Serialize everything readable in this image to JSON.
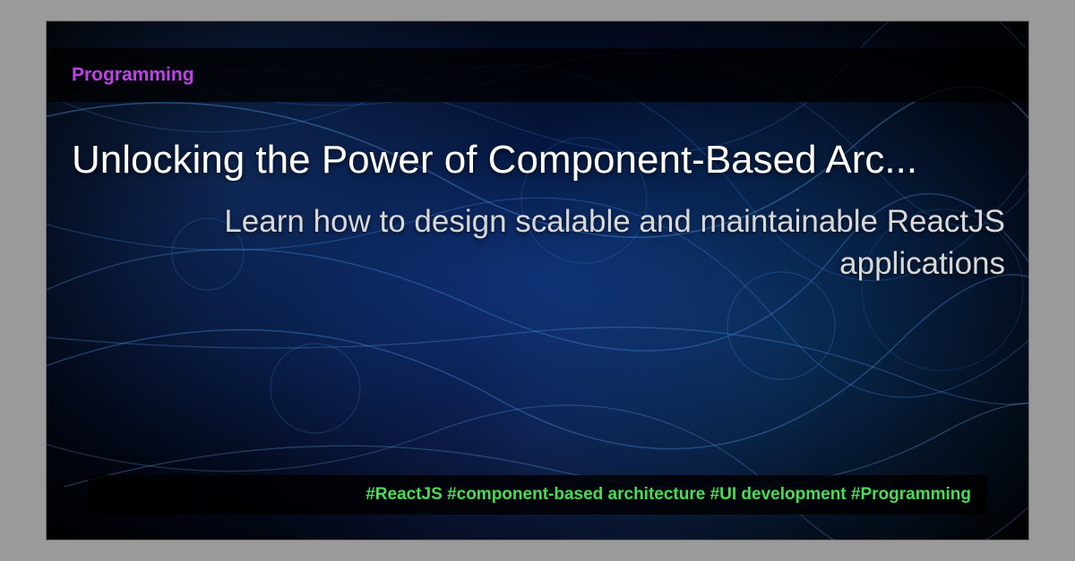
{
  "category": "Programming",
  "title": "Unlocking the Power of Component-Based Arc...",
  "subtitle": "Learn how to design scalable and maintainable ReactJS applications",
  "tags": "#ReactJS #component-based architecture #UI development #Programming"
}
